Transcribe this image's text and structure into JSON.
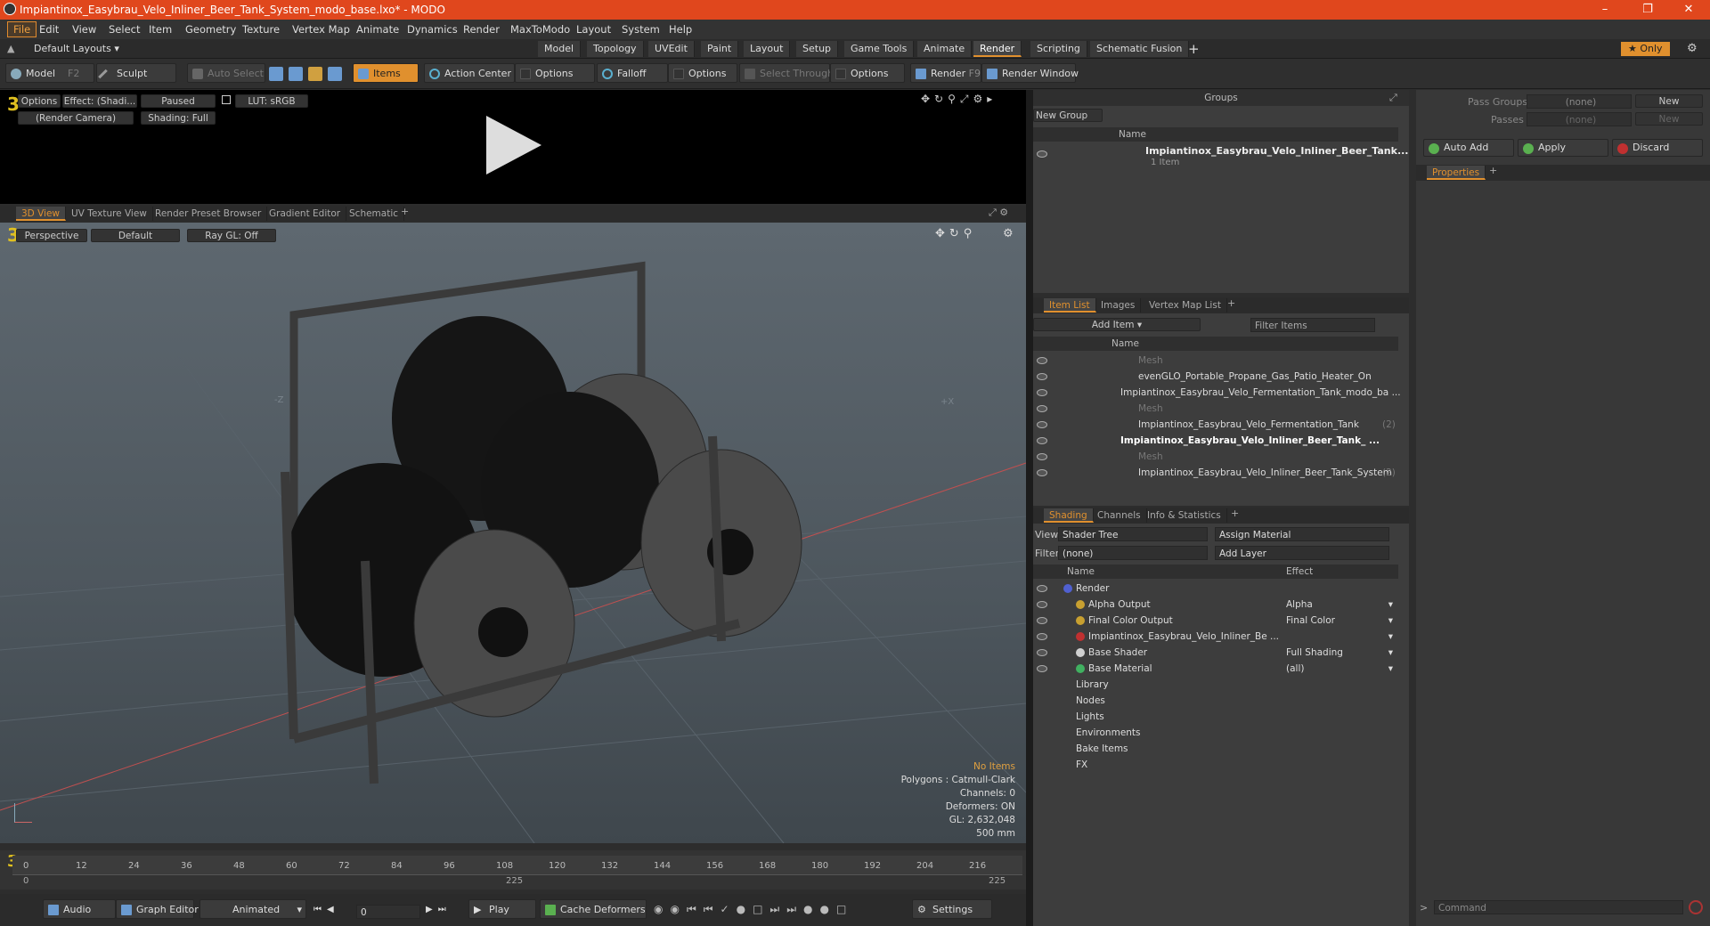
{
  "window": {
    "title": "Impiantinox_Easybrau_Velo_Inliner_Beer_Tank_System_modo_base.lxo* - MODO"
  },
  "menu": [
    "File",
    "Edit",
    "View",
    "Select",
    "Item",
    "Geometry",
    "Texture",
    "Vertex Map",
    "Animate",
    "Dynamics",
    "Render",
    "MaxToModo",
    "Layout",
    "System",
    "Help"
  ],
  "layoutbar": {
    "layouts_label": "Default Layouts",
    "tabs": [
      "Model",
      "Topology",
      "UVEdit",
      "Paint",
      "Layout",
      "Setup",
      "Game Tools",
      "Animate",
      "Render",
      "Scripting",
      "Schematic Fusion"
    ],
    "selected_tab": "Render",
    "only_label": "Only"
  },
  "toolbar": {
    "model": "Model",
    "model_key": "F2",
    "sculpt": "Sculpt",
    "auto_select": "Auto Select",
    "items": "Items",
    "action_center": "Action Center",
    "options1": "Options",
    "falloff": "Falloff",
    "options2": "Options",
    "select_through": "Select Through",
    "options3": "Options",
    "render": "Render",
    "render_key": "F9",
    "render_window": "Render Window"
  },
  "render_preview": {
    "options": "Options",
    "effect": "Effect: (Shadi...",
    "paused": "Paused",
    "lut": "LUT: sRGB",
    "camera": "(Render Camera)",
    "shading": "Shading: Full"
  },
  "viewport_tabs": [
    "3D View",
    "UV Texture View",
    "Render Preset Browser",
    "Gradient Editor",
    "Schematic"
  ],
  "viewport": {
    "perspective": "Perspective",
    "default": "Default",
    "raygl": "Ray GL: Off",
    "axis_z": "-Z",
    "axis_x": "+X",
    "hud": {
      "no_items": "No Items",
      "polygons": "Polygons : Catmull-Clark",
      "channels": "Channels: 0",
      "deformers": "Deformers: ON",
      "gl": "GL: 2,632,048",
      "size": "500 mm"
    }
  },
  "timeline": {
    "ticks": [
      "0",
      "12",
      "24",
      "36",
      "48",
      "60",
      "72",
      "84",
      "96",
      "108",
      "120",
      "132",
      "144",
      "156",
      "168",
      "180",
      "192",
      "204",
      "216"
    ],
    "sub_ticks": [
      "0",
      "225",
      "225"
    ]
  },
  "bottombar": {
    "audio": "Audio",
    "graph_editor": "Graph Editor",
    "animated": "Animated",
    "frame": "0",
    "play": "Play",
    "cache_deformers": "Cache Deformers",
    "settings": "Settings"
  },
  "groups": {
    "title": "Groups",
    "new_group": "New Group",
    "col_name": "Name",
    "item_name": "Impiantinox_Easybrau_Velo_Inliner_Beer_Tank...",
    "item_count": "1 Item"
  },
  "item_list": {
    "tabs": [
      "Item List",
      "Images",
      "Vertex Map List"
    ],
    "add_item": "Add Item",
    "filter_items": "Filter Items",
    "col_name": "Name",
    "rows": [
      {
        "label": "Mesh",
        "dim": true,
        "indent": 2
      },
      {
        "label": "evenGLO_Portable_Propane_Gas_Patio_Heater_On",
        "dim": false,
        "indent": 2
      },
      {
        "label": "Impiantinox_Easybrau_Velo_Fermentation_Tank_modo_ba ...",
        "dim": false,
        "indent": 1
      },
      {
        "label": "Mesh",
        "dim": true,
        "indent": 2
      },
      {
        "label": "Impiantinox_Easybrau_Velo_Fermentation_Tank",
        "suffix": "(2)",
        "dim": false,
        "indent": 2
      },
      {
        "label": "Impiantinox_Easybrau_Velo_Inliner_Beer_Tank_ ...",
        "dim": false,
        "bold": true,
        "indent": 1
      },
      {
        "label": "Mesh",
        "dim": true,
        "indent": 2
      },
      {
        "label": "Impiantinox_Easybrau_Velo_Inliner_Beer_Tank_System",
        "suffix": "(2)",
        "dim": false,
        "indent": 2
      }
    ]
  },
  "shading": {
    "tabs": [
      "Shading",
      "Channels",
      "Info & Statistics"
    ],
    "view_label": "View",
    "view_value": "Shader Tree",
    "assign_material": "Assign Material",
    "filter_label": "Filter",
    "filter_value": "(none)",
    "add_layer": "Add Layer",
    "col_name": "Name",
    "col_effect": "Effect",
    "rows": [
      {
        "name": "Render",
        "effect": "",
        "indent": 0,
        "color": "#5060d0"
      },
      {
        "name": "Alpha Output",
        "effect": "Alpha",
        "indent": 1,
        "color": "#c8a030"
      },
      {
        "name": "Final Color Output",
        "effect": "Final Color",
        "indent": 1,
        "color": "#c8a030"
      },
      {
        "name": "Impiantinox_Easybrau_Velo_Inliner_Be ...",
        "effect": "",
        "indent": 1,
        "color": "#c03030"
      },
      {
        "name": "Base Shader",
        "effect": "Full Shading",
        "indent": 1,
        "color": "#d0d0d0"
      },
      {
        "name": "Base Material",
        "effect": "(all)",
        "indent": 1,
        "color": "#40b060"
      },
      {
        "name": "Library",
        "effect": "",
        "indent": 0,
        "color": ""
      },
      {
        "name": "Nodes",
        "effect": "",
        "indent": 0,
        "color": ""
      },
      {
        "name": "Lights",
        "effect": "",
        "indent": 0,
        "color": ""
      },
      {
        "name": "Environments",
        "effect": "",
        "indent": 0,
        "color": ""
      },
      {
        "name": "Bake Items",
        "effect": "",
        "indent": 0,
        "color": ""
      },
      {
        "name": "FX",
        "effect": "",
        "indent": 0,
        "color": ""
      }
    ]
  },
  "properties": {
    "pass_groups_label": "Pass Groups",
    "pass_groups_value": "(none)",
    "new1": "New",
    "passes_label": "Passes",
    "passes_value": "(none)",
    "new2": "New",
    "auto_add": "Auto Add",
    "apply": "Apply",
    "discard": "Discard",
    "tab": "Properties",
    "command_placeholder": "Command"
  }
}
